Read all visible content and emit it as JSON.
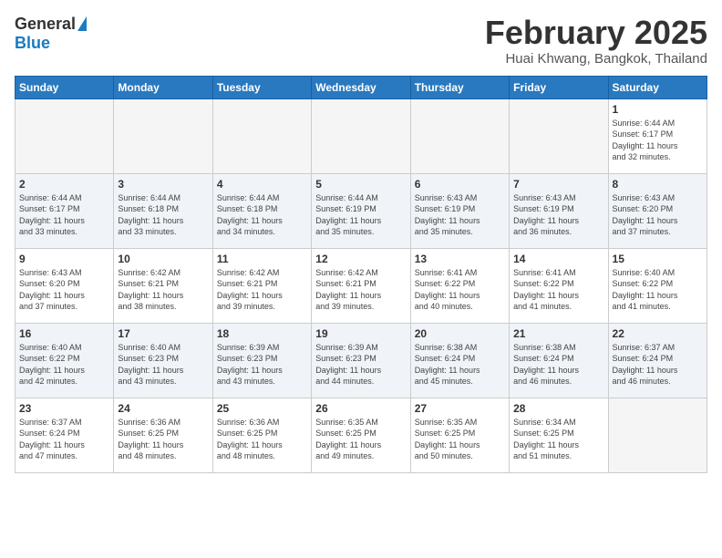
{
  "header": {
    "logo_general": "General",
    "logo_blue": "Blue",
    "month_title": "February 2025",
    "location": "Huai Khwang, Bangkok, Thailand"
  },
  "weekdays": [
    "Sunday",
    "Monday",
    "Tuesday",
    "Wednesday",
    "Thursday",
    "Friday",
    "Saturday"
  ],
  "weeks": [
    [
      {
        "day": "",
        "info": ""
      },
      {
        "day": "",
        "info": ""
      },
      {
        "day": "",
        "info": ""
      },
      {
        "day": "",
        "info": ""
      },
      {
        "day": "",
        "info": ""
      },
      {
        "day": "",
        "info": ""
      },
      {
        "day": "1",
        "info": "Sunrise: 6:44 AM\nSunset: 6:17 PM\nDaylight: 11 hours\nand 32 minutes."
      }
    ],
    [
      {
        "day": "2",
        "info": "Sunrise: 6:44 AM\nSunset: 6:17 PM\nDaylight: 11 hours\nand 33 minutes."
      },
      {
        "day": "3",
        "info": "Sunrise: 6:44 AM\nSunset: 6:18 PM\nDaylight: 11 hours\nand 33 minutes."
      },
      {
        "day": "4",
        "info": "Sunrise: 6:44 AM\nSunset: 6:18 PM\nDaylight: 11 hours\nand 34 minutes."
      },
      {
        "day": "5",
        "info": "Sunrise: 6:44 AM\nSunset: 6:19 PM\nDaylight: 11 hours\nand 35 minutes."
      },
      {
        "day": "6",
        "info": "Sunrise: 6:43 AM\nSunset: 6:19 PM\nDaylight: 11 hours\nand 35 minutes."
      },
      {
        "day": "7",
        "info": "Sunrise: 6:43 AM\nSunset: 6:19 PM\nDaylight: 11 hours\nand 36 minutes."
      },
      {
        "day": "8",
        "info": "Sunrise: 6:43 AM\nSunset: 6:20 PM\nDaylight: 11 hours\nand 37 minutes."
      }
    ],
    [
      {
        "day": "9",
        "info": "Sunrise: 6:43 AM\nSunset: 6:20 PM\nDaylight: 11 hours\nand 37 minutes."
      },
      {
        "day": "10",
        "info": "Sunrise: 6:42 AM\nSunset: 6:21 PM\nDaylight: 11 hours\nand 38 minutes."
      },
      {
        "day": "11",
        "info": "Sunrise: 6:42 AM\nSunset: 6:21 PM\nDaylight: 11 hours\nand 39 minutes."
      },
      {
        "day": "12",
        "info": "Sunrise: 6:42 AM\nSunset: 6:21 PM\nDaylight: 11 hours\nand 39 minutes."
      },
      {
        "day": "13",
        "info": "Sunrise: 6:41 AM\nSunset: 6:22 PM\nDaylight: 11 hours\nand 40 minutes."
      },
      {
        "day": "14",
        "info": "Sunrise: 6:41 AM\nSunset: 6:22 PM\nDaylight: 11 hours\nand 41 minutes."
      },
      {
        "day": "15",
        "info": "Sunrise: 6:40 AM\nSunset: 6:22 PM\nDaylight: 11 hours\nand 41 minutes."
      }
    ],
    [
      {
        "day": "16",
        "info": "Sunrise: 6:40 AM\nSunset: 6:22 PM\nDaylight: 11 hours\nand 42 minutes."
      },
      {
        "day": "17",
        "info": "Sunrise: 6:40 AM\nSunset: 6:23 PM\nDaylight: 11 hours\nand 43 minutes."
      },
      {
        "day": "18",
        "info": "Sunrise: 6:39 AM\nSunset: 6:23 PM\nDaylight: 11 hours\nand 43 minutes."
      },
      {
        "day": "19",
        "info": "Sunrise: 6:39 AM\nSunset: 6:23 PM\nDaylight: 11 hours\nand 44 minutes."
      },
      {
        "day": "20",
        "info": "Sunrise: 6:38 AM\nSunset: 6:24 PM\nDaylight: 11 hours\nand 45 minutes."
      },
      {
        "day": "21",
        "info": "Sunrise: 6:38 AM\nSunset: 6:24 PM\nDaylight: 11 hours\nand 46 minutes."
      },
      {
        "day": "22",
        "info": "Sunrise: 6:37 AM\nSunset: 6:24 PM\nDaylight: 11 hours\nand 46 minutes."
      }
    ],
    [
      {
        "day": "23",
        "info": "Sunrise: 6:37 AM\nSunset: 6:24 PM\nDaylight: 11 hours\nand 47 minutes."
      },
      {
        "day": "24",
        "info": "Sunrise: 6:36 AM\nSunset: 6:25 PM\nDaylight: 11 hours\nand 48 minutes."
      },
      {
        "day": "25",
        "info": "Sunrise: 6:36 AM\nSunset: 6:25 PM\nDaylight: 11 hours\nand 48 minutes."
      },
      {
        "day": "26",
        "info": "Sunrise: 6:35 AM\nSunset: 6:25 PM\nDaylight: 11 hours\nand 49 minutes."
      },
      {
        "day": "27",
        "info": "Sunrise: 6:35 AM\nSunset: 6:25 PM\nDaylight: 11 hours\nand 50 minutes."
      },
      {
        "day": "28",
        "info": "Sunrise: 6:34 AM\nSunset: 6:25 PM\nDaylight: 11 hours\nand 51 minutes."
      },
      {
        "day": "",
        "info": ""
      }
    ]
  ]
}
